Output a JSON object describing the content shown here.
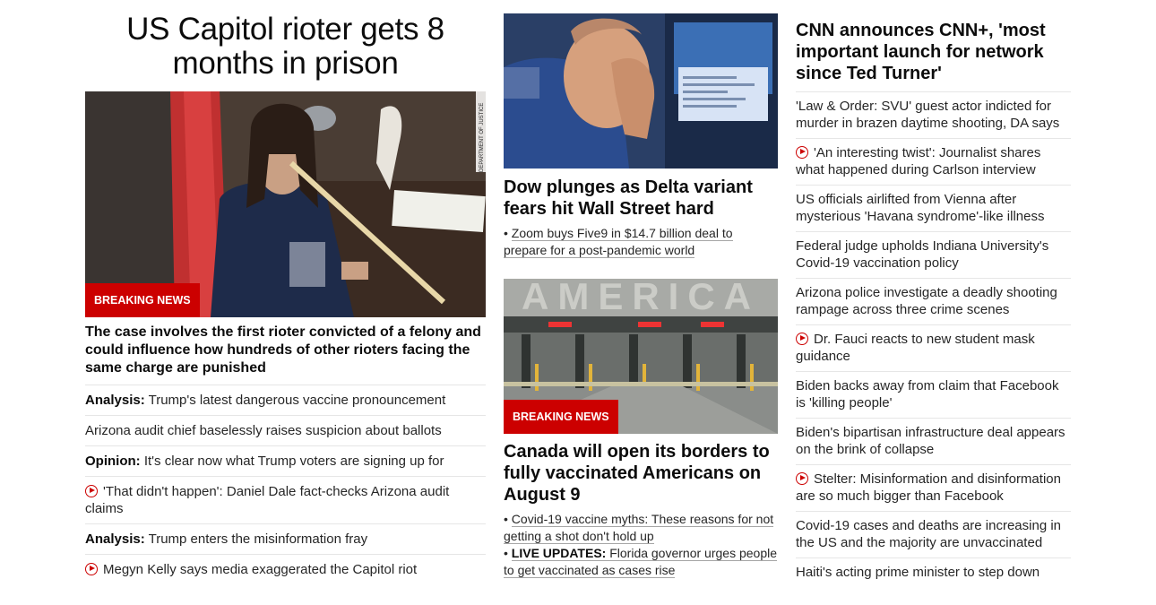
{
  "lead": {
    "title": "US Capitol rioter gets 8 months in prison",
    "badge": "BREAKING NEWS",
    "photo_watermark": "DEPARTMENT OF JUSTICE",
    "description": "The case involves the first rioter convicted of a felony and could influence how hundreds of other rioters facing the same charge are punished",
    "related": [
      {
        "kicker": "Analysis:",
        "text": " Trump's latest dangerous vaccine pronouncement",
        "video": false
      },
      {
        "kicker": "",
        "text": "Arizona audit chief baselessly raises suspicion about ballots",
        "video": false
      },
      {
        "kicker": "Opinion:",
        "text": " It's clear now what Trump voters are signing up for",
        "video": false
      },
      {
        "kicker": "",
        "text": "'That didn't happen': Daniel Dale fact-checks Arizona audit claims",
        "video": true
      },
      {
        "kicker": "Analysis:",
        "text": " Trump enters the misinformation fray",
        "video": false
      },
      {
        "kicker": "",
        "text": "Megyn Kelly says media exaggerated the Capitol riot",
        "video": true
      }
    ]
  },
  "middle": {
    "story1": {
      "headline": "Dow plunges as Delta variant fears hit Wall Street hard",
      "sub_bullet": "• ",
      "sub": "Zoom buys Five9 in $14.7 billion deal to prepare for a post-pandemic world"
    },
    "story2": {
      "badge": "BREAKING NEWS",
      "sign_text": "AMERICA",
      "headline": "Canada will open its borders to fully vaccinated Americans on August 9",
      "sub1_bullet": "• ",
      "sub1": "Covid-19 vaccine myths: These reasons for not getting a shot don't hold up",
      "sub2_bullet": "• ",
      "sub2_kicker": "LIVE UPDATES:",
      "sub2": " Florida governor urges people to get vaccinated as cases rise"
    }
  },
  "right": {
    "headline": "CNN announces CNN+, 'most important launch for network since Ted Turner'",
    "items": [
      {
        "text": "'Law & Order: SVU' guest actor indicted for murder in brazen daytime shooting, DA says",
        "video": false
      },
      {
        "text": "'An interesting twist': Journalist shares what happened during Carlson interview",
        "video": true
      },
      {
        "text": "US officials airlifted from Vienna after mysterious 'Havana syndrome'-like illness",
        "video": false
      },
      {
        "text": "Federal judge upholds Indiana University's Covid-19 vaccination policy",
        "video": false
      },
      {
        "text": "Arizona police investigate a deadly shooting rampage across three crime scenes",
        "video": false
      },
      {
        "text": "Dr. Fauci reacts to new student mask guidance",
        "video": true
      },
      {
        "text": "Biden backs away from claim that Facebook is 'killing people'",
        "video": false
      },
      {
        "text": "Biden's bipartisan infrastructure deal appears on the brink of collapse",
        "video": false
      },
      {
        "text": "Stelter: Misinformation and disinformation are so much bigger than Facebook",
        "video": true
      },
      {
        "text": "Covid-19 cases and deaths are increasing in the US and the majority are unvaccinated",
        "video": false
      },
      {
        "text": "Haiti's acting prime minister to step down",
        "video": false
      }
    ]
  },
  "colors": {
    "accent_red": "#cc0000",
    "text": "#262626",
    "divider": "#e6e6e6"
  },
  "icons": {
    "video": "play-circle-icon"
  }
}
